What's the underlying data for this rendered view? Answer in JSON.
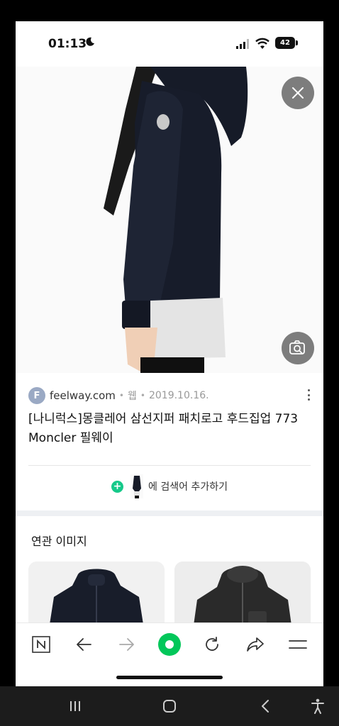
{
  "status_bar": {
    "time": "01:13",
    "battery_level": "42",
    "icons": [
      "moon-icon",
      "signal-icon",
      "wifi-icon",
      "battery-icon"
    ]
  },
  "viewer": {
    "close_icon": "close-icon",
    "lens_icon": "lens-search-icon"
  },
  "result": {
    "favicon_letter": "F",
    "domain": "feelway.com",
    "type": "웹",
    "date": "2019.10.16.",
    "title": "[나니럭스]몽클레어 삼선지퍼 패치로고 후드집업 773 Moncler 필웨이",
    "add_search_label": "에 검색어 추가하기"
  },
  "related": {
    "title": "연관 이미지"
  },
  "toolbar": {
    "items": [
      "naver-home-icon",
      "back-arrow-icon",
      "forward-arrow-icon",
      "green-dot-icon",
      "refresh-icon",
      "share-icon",
      "menu-icon"
    ],
    "accent": "#03c75a"
  },
  "android_nav": {
    "items": [
      "recents-icon",
      "home-icon",
      "back-icon",
      "accessibility-icon"
    ]
  }
}
